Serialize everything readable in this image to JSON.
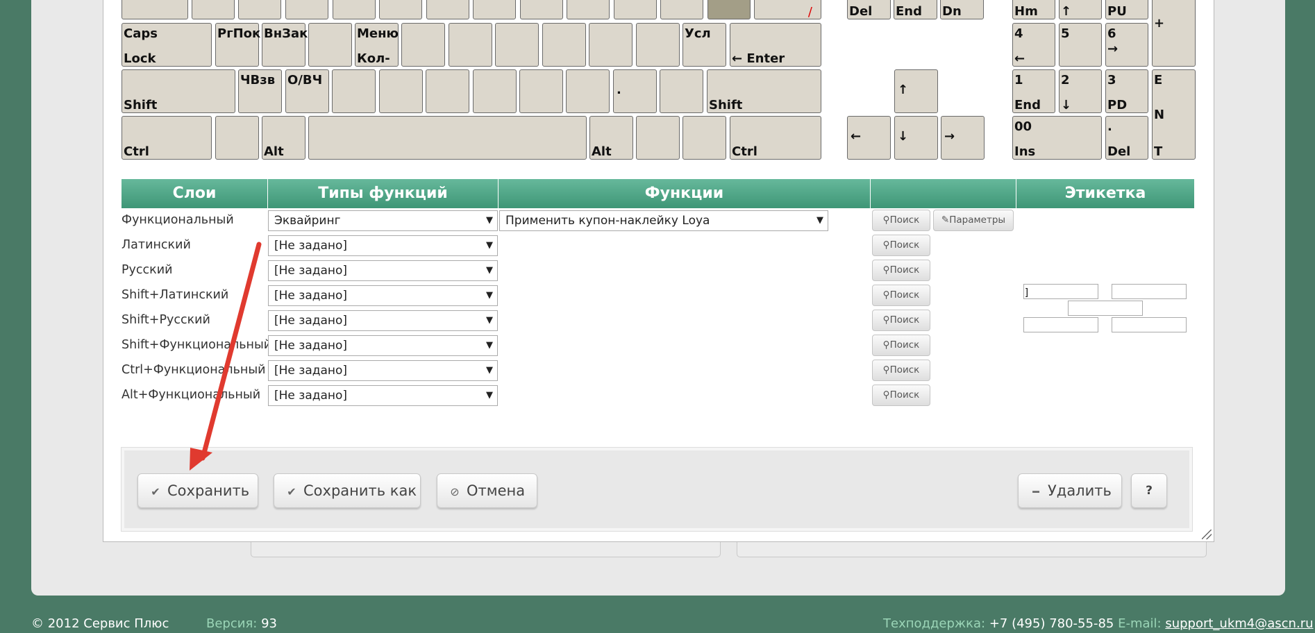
{
  "keyboard": {
    "row0": {
      "del": "Del",
      "end": "End",
      "dn": "Dn",
      "hm": "Hm",
      "up": "↑",
      "pu": "PU",
      "plus": "+",
      "red": "/"
    },
    "row1": {
      "caps_top": "Caps",
      "caps_bot": "Lock",
      "pgpok": "РгПок",
      "vnzak": "ВнЗак",
      "menu_top": "Меню",
      "menu_bot": "Кол-",
      "usl": "Усл",
      "enter": "← Enter",
      "n4": "4",
      "n4b": "←",
      "n5": "5",
      "n6": "6",
      "n6b": "→"
    },
    "row2": {
      "shift": "Shift",
      "chvzv": "ЧВзв",
      "ovch": "О/ВЧ",
      "dot": ".",
      "shift_r": "Shift",
      "up": "↑",
      "n1": "1",
      "n1b": "End",
      "n2": "2",
      "n2b": "↓",
      "n3": "3",
      "n3b": "PD",
      "ent_t": "E",
      "ent_m": "N",
      "ent_b": "T"
    },
    "row3": {
      "ctrl": "Ctrl",
      "alt": "Alt",
      "alt_r": "Alt",
      "ctrl_r": "Ctrl",
      "left": "←",
      "down": "↓",
      "right": "→",
      "n0": "00",
      "n0b": "Ins",
      "ndot": ".",
      "ndotb": "Del"
    }
  },
  "table": {
    "headers": {
      "layers": "Слои",
      "func_types": "Типы функций",
      "functions": "Функции",
      "actions": "",
      "label": "Этикетка"
    },
    "rows": [
      {
        "layer": "Функциональный",
        "type": "Эквайринг",
        "function": "Применить купон-наклейку Loya"
      },
      {
        "layer": "Латинский",
        "type": "[Не задано]"
      },
      {
        "layer": "Русский",
        "type": "[Не задано]"
      },
      {
        "layer": "Shift+Латинский",
        "type": "[Не задано]"
      },
      {
        "layer": "Shift+Русский",
        "type": "[Не задано]"
      },
      {
        "layer": "Shift+Функциональный",
        "type": "[Не задано]"
      },
      {
        "layer": "Ctrl+Функциональный",
        "type": "[Не задано]"
      },
      {
        "layer": "Alt+Функциональный",
        "type": "[Не задано]"
      }
    ],
    "search_label": "Поиск",
    "params_label": "Параметры",
    "label_first_value": "]"
  },
  "buttons": {
    "save": "Сохранить",
    "save_as": "Сохранить как",
    "cancel": "Отмена",
    "delete": "Удалить",
    "help": "?"
  },
  "footer": {
    "copyright": "© 2012 Сервис Плюс",
    "version_label": "Версия:",
    "version": "93",
    "support_label": "Техподдержка:",
    "support_phone": "+7 (495) 780-55-85",
    "email_label": "E-mail:",
    "email": "support_ukm4@ascn.ru"
  },
  "colors": {
    "background": "#4a7a66",
    "header": "#4fa585",
    "key": "#dcd7cc",
    "arrow": "#e03a2f"
  }
}
